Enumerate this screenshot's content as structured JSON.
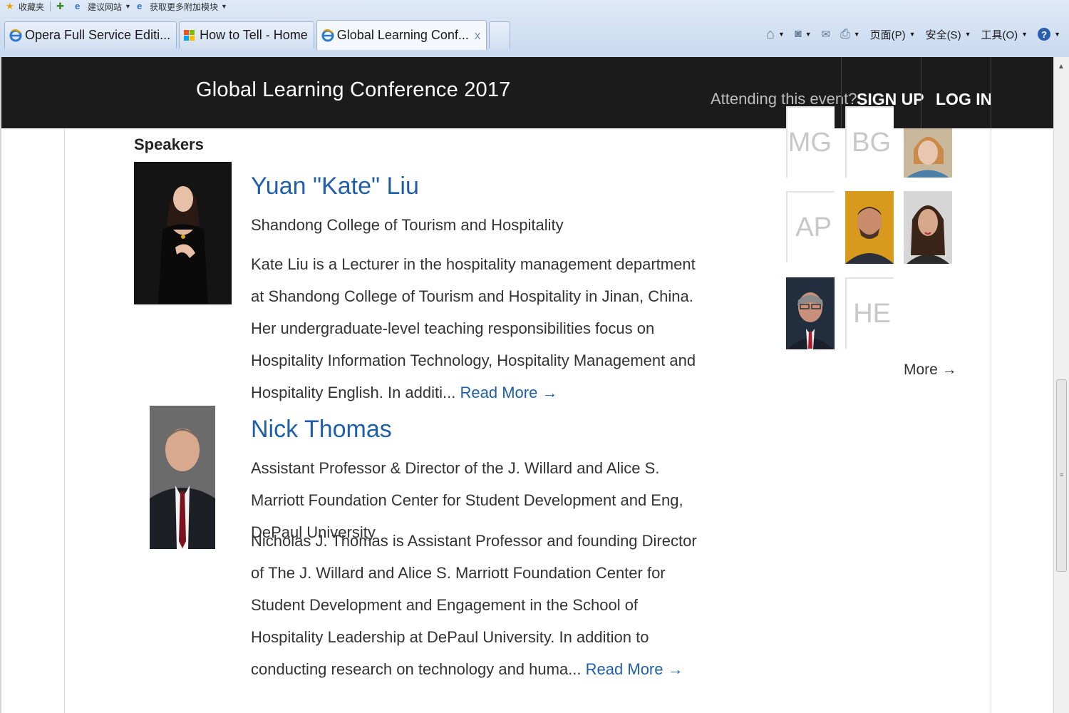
{
  "browser": {
    "favorites_bar": [
      {
        "label": "收藏夹",
        "icon": "star-icon"
      },
      {
        "label": "建议网站",
        "icon": "ie-icon"
      },
      {
        "label": "获取更多附加模块",
        "icon": "ie-icon"
      }
    ],
    "tabs": [
      {
        "label": "Opera Full Service Editi...",
        "icon": "ie-icon"
      },
      {
        "label": "How to Tell - Home",
        "icon": "windows-icon"
      },
      {
        "label": "Global Learning Conf...",
        "icon": "ie-icon",
        "active": true
      }
    ],
    "tab_close": "x",
    "commands": {
      "page": "页面(P)",
      "safety": "安全(S)",
      "tools": "工具(O)"
    }
  },
  "site": {
    "title": "Global Learning Conference 2017",
    "attending": "Attending this event?",
    "signup": "SIGN UP",
    "login": "LOG IN"
  },
  "section_title": "Speakers",
  "speakers": [
    {
      "name": "Yuan \"Kate\" Liu",
      "org": "Shandong College of Tourism and Hospitality",
      "bio": "Kate Liu is a Lecturer in the hospitality management department at Shandong College of Tourism and Hospitality in Jinan, China. Her undergraduate-level teaching responsibilities focus on Hospitality Information Technology, Hospitality Management and Hospitality English. In additi...",
      "read_more": "Read More →"
    },
    {
      "name": "Nick Thomas",
      "org": "Assistant Professor & Director of the J. Willard and Alice S. Marriott Foundation Center for Student Development and Eng, DePaul University",
      "bio": "Nicholas J. Thomas is Assistant Professor and founding Director of The J. Willard and Alice S. Marriott Foundation Center for Student Development and Engagement in the School of Hospitality Leadership at DePaul University. In addition to conducting research on technology and huma...",
      "read_more": "Read More →"
    }
  ],
  "sidebar": {
    "initials": [
      "MG",
      "BG",
      "AP",
      "HE"
    ],
    "more": "More →"
  }
}
